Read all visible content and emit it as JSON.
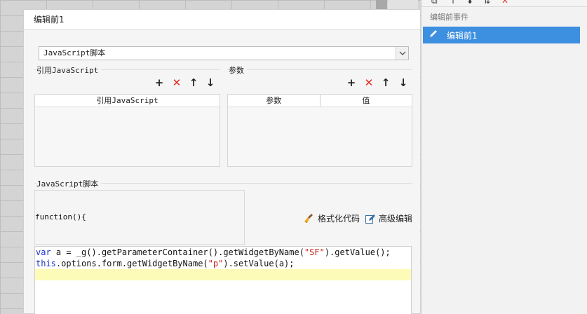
{
  "right_panel": {
    "header": "编辑前事件",
    "items": [
      {
        "label": "编辑前1",
        "selected": true
      }
    ],
    "accent_color": "#3d8fe0"
  },
  "dialog": {
    "title": "编辑前1",
    "script_type": {
      "selected": "JavaScript脚本"
    },
    "ref_js": {
      "section_label": "引用JavaScript",
      "columns": [
        "引用JavaScript"
      ],
      "rows": []
    },
    "params": {
      "section_label": "参数",
      "columns": [
        "参数",
        "值"
      ],
      "rows": []
    },
    "script": {
      "section_label": "JavaScript脚本",
      "function_header": "function(){",
      "format_label": "格式化代码",
      "advanced_label": "高级编辑",
      "code_lines": [
        [
          {
            "t": "kw",
            "v": "var"
          },
          {
            "t": "plain",
            "v": " a = _g().getParameterContainer().getWidgetByName("
          },
          {
            "t": "str",
            "v": "\"SF\""
          },
          {
            "t": "plain",
            "v": ").getValue();"
          }
        ],
        [
          {
            "t": "kw",
            "v": "this"
          },
          {
            "t": "plain",
            "v": ".options.form.getWidgetByName("
          },
          {
            "t": "str",
            "v": "\"p\""
          },
          {
            "t": "plain",
            "v": ").setValue(a);"
          }
        ],
        []
      ]
    }
  }
}
